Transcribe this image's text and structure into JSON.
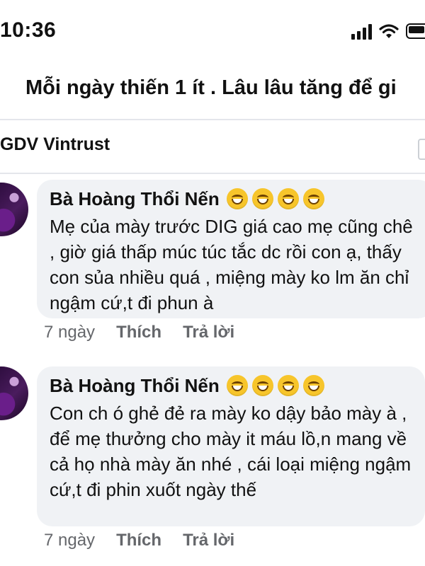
{
  "status_bar": {
    "time": "10:36"
  },
  "post": {
    "title": "Mỗi ngày thiến 1 ít . Lâu lâu tăng để gi"
  },
  "group": {
    "name": "GDV Vintrust"
  },
  "comments": [
    {
      "author": "Bà Hoàng Thổi Nến",
      "emoji_count": 4,
      "text": "Mẹ của mày trước DIG giá cao mẹ cũng chê , giờ giá thấp múc túc tắc dc rồi con ạ, thấy con sủa nhiều quá , miệng mày ko lm ăn chỉ ngậm cứ,t đi phun à",
      "time": "7 ngày",
      "like": "Thích",
      "reply": "Trả lời"
    },
    {
      "author": "Bà Hoàng Thổi Nến",
      "emoji_count": 4,
      "text": "Con ch ó ghẻ đẻ ra mày ko dậy bảo mày à , để mẹ thưởng cho mày it máu lồ,n mang về cả họ nhà mày ăn nhé , cái loại miệng ngậm cứ,t đi phin xuốt ngày thế",
      "time": "7 ngày",
      "like": "Thích",
      "reply": "Trả lời"
    }
  ]
}
